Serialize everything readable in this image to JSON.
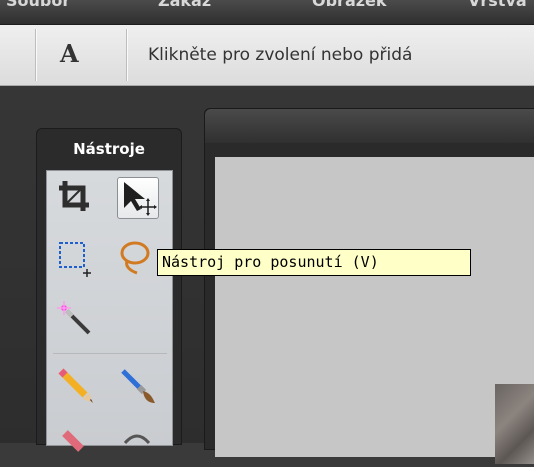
{
  "menu": {
    "items": [
      {
        "label": "Soubor"
      },
      {
        "label": "Zákaz"
      },
      {
        "label": "Obrázek"
      },
      {
        "label": "Vrstva"
      }
    ]
  },
  "options_bar": {
    "tool_icon": "text-tool-icon",
    "tool_glyph": "A",
    "hint": "Klikněte pro zvolení nebo přidá"
  },
  "tools_panel": {
    "title": "Nástroje",
    "tools": [
      {
        "name": "crop-tool",
        "icon": "crop-icon"
      },
      {
        "name": "move-tool",
        "icon": "move-arrow-icon",
        "active": true
      },
      {
        "name": "marquee-tool",
        "icon": "rectangle-marquee-icon"
      },
      {
        "name": "lasso-tool",
        "icon": "lasso-icon"
      },
      {
        "name": "magic-wand-tool",
        "icon": "magic-wand-icon"
      },
      {
        "name": "pencil-tool",
        "icon": "pencil-icon"
      },
      {
        "name": "brush-tool",
        "icon": "brush-icon"
      }
    ]
  },
  "tooltip": {
    "text": "Nástroj pro posunutí (V)"
  },
  "colors": {
    "tooltip_bg": "#ffffc8",
    "panel_bg": "#2b2b2b",
    "canvas_bg": "#c6c6c6"
  }
}
